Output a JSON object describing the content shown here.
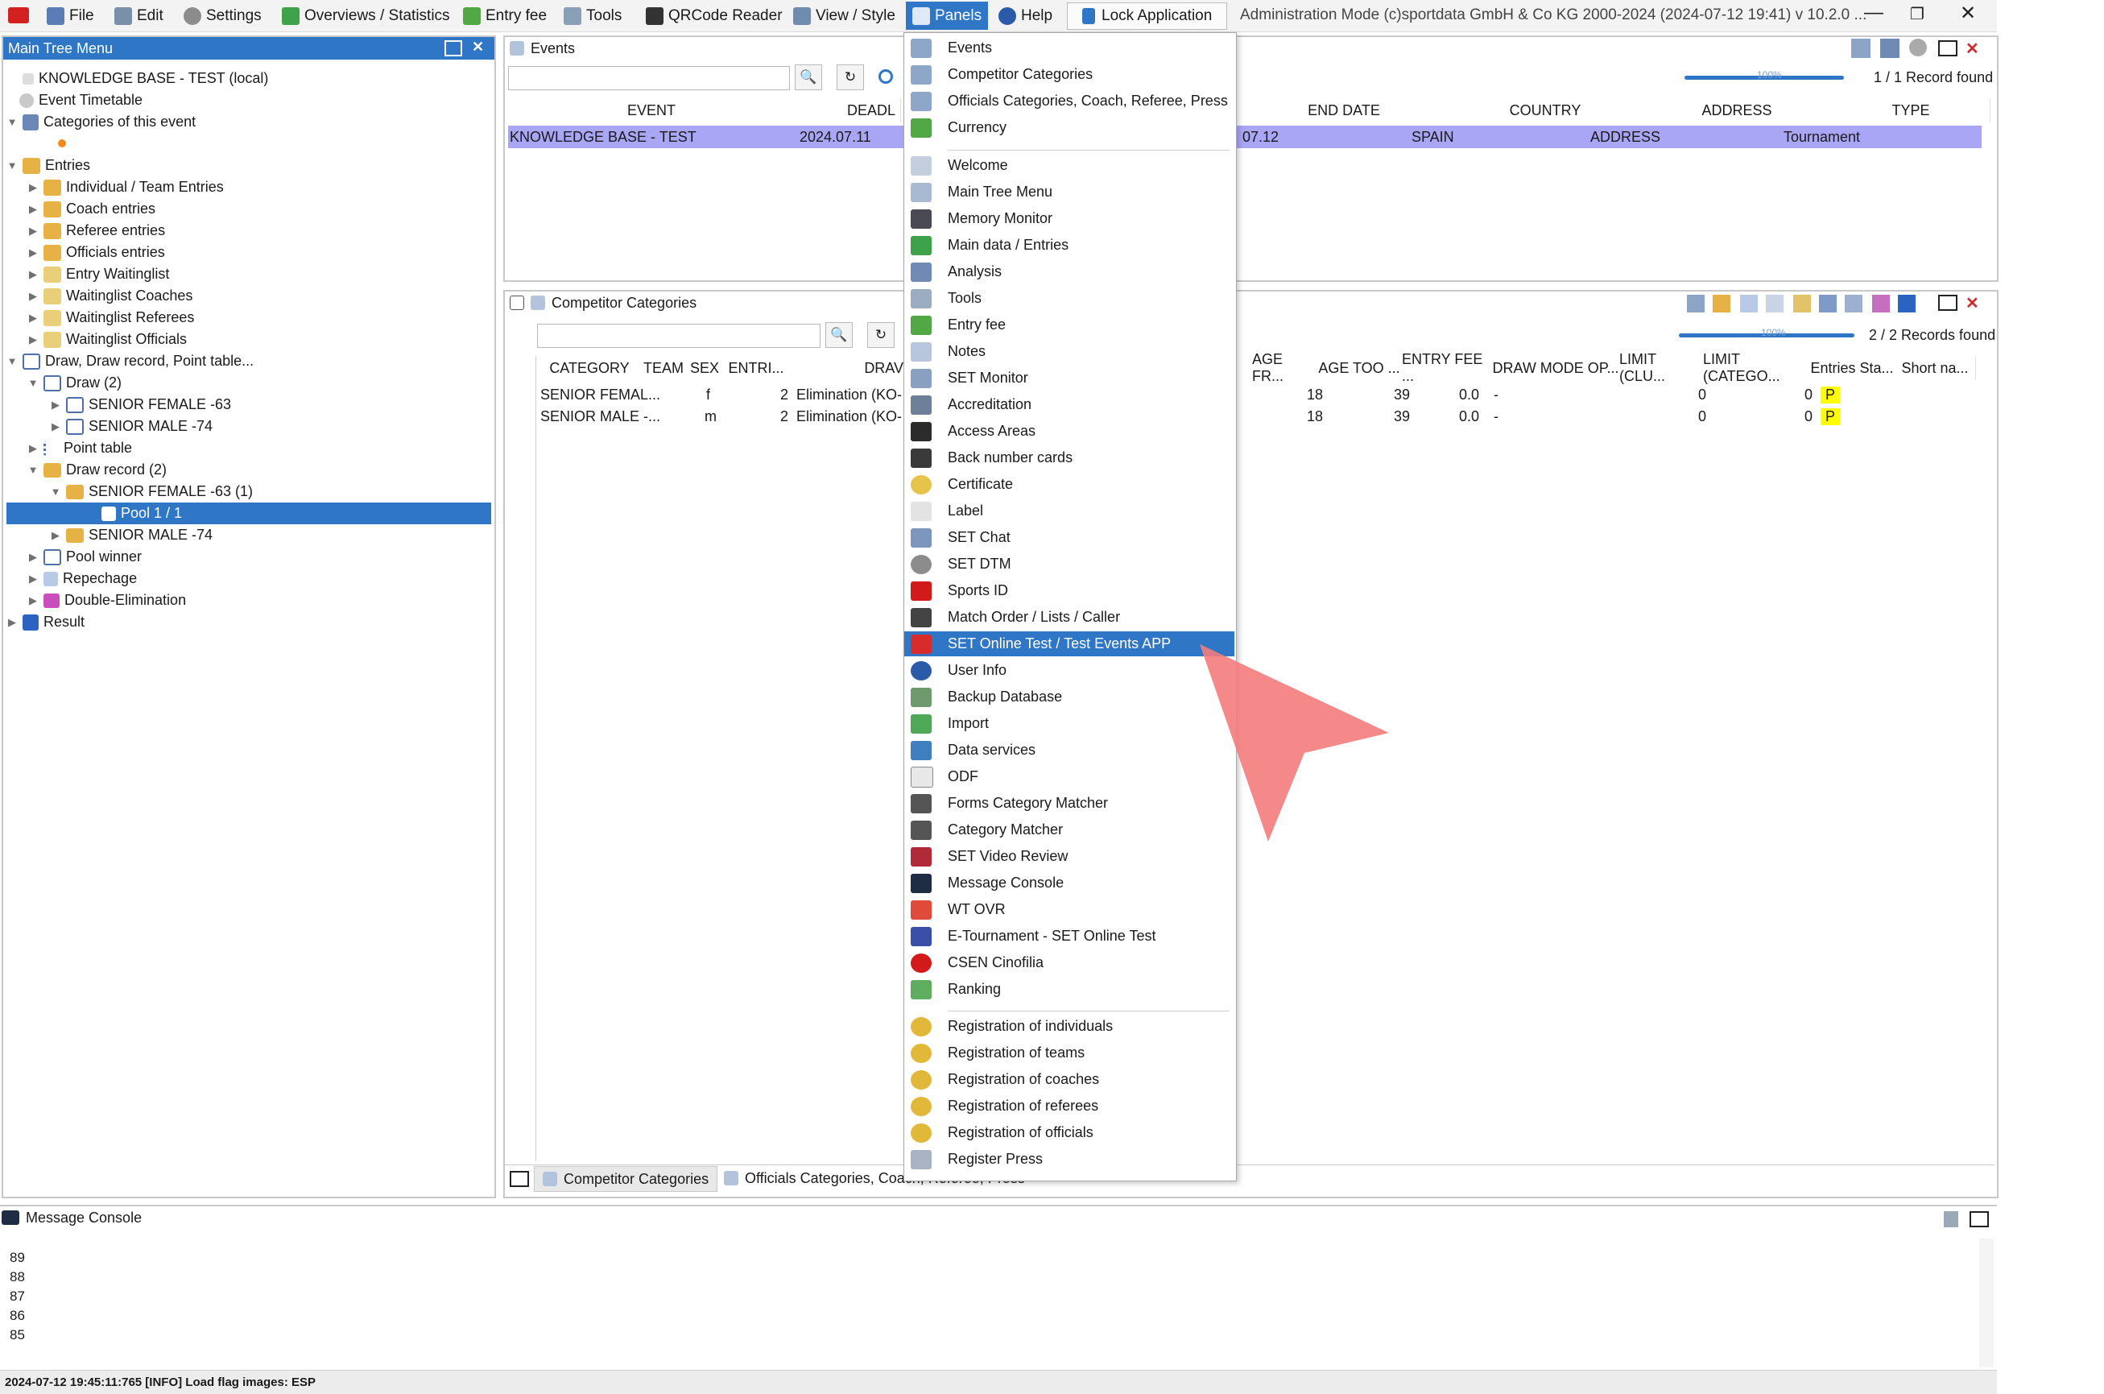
{
  "menubar": {
    "items": [
      "File",
      "Edit",
      "Settings",
      "Overviews / Statistics",
      "Entry fee",
      "Tools",
      "QRCode Reader",
      "View / Style",
      "Panels",
      "Help"
    ],
    "lock": "Lock Application",
    "title": "Administration Mode (c)sportdata GmbH & Co KG 2000-2024 (2024-07-12 19:41)  v 10.2.0 ..."
  },
  "tree": {
    "title": "Main Tree Menu",
    "rows": [
      "KNOWLEDGE BASE - TEST (local)",
      "Event Timetable",
      "Categories of this event",
      "Entries",
      "Individual / Team Entries",
      "Coach entries",
      "Referee entries",
      "Officials entries",
      "Entry Waitinglist",
      "Waitinglist Coaches",
      "Waitinglist Referees",
      "Waitinglist Officials",
      "Draw, Draw record, Point table...",
      "Draw (2)",
      "SENIOR FEMALE -63",
      "SENIOR MALE -74",
      "Point table",
      "Draw record (2)",
      "SENIOR FEMALE -63 (1)",
      "Pool 1 / 1",
      "SENIOR MALE -74",
      "Pool winner",
      "Repechage",
      "Double-Elimination",
      "Result"
    ]
  },
  "events": {
    "title": "Events",
    "records": "1 / 1 Record found",
    "progress_label": "100%",
    "columns": [
      "EVENT",
      "DEADL",
      "END DATE",
      "COUNTRY",
      "ADDRESS",
      "TYPE"
    ],
    "row": {
      "event": "KNOWLEDGE BASE - TEST",
      "deadline": "2024.07.11",
      "end": "07.12",
      "country": "SPAIN",
      "address": "ADDRESS",
      "type": "Tournament"
    }
  },
  "categories": {
    "title": "Competitor Categories",
    "records": "2 / 2 Records found",
    "progress_label": "100%",
    "columns": [
      "CATEGORY",
      "TEAM",
      "SEX",
      "ENTRI...",
      "DRAV",
      "AGE FR...",
      "AGE TOO ...",
      "ENTRY FEE ...",
      "DRAW MODE OP...",
      "LIMIT (CLU...",
      "LIMIT (CATEGO...",
      "Entries Sta...",
      "Short na..."
    ],
    "rows": [
      {
        "cat": "SENIOR FEMAL...",
        "sex": "f",
        "entries": "2",
        "draw": "Elimination (KO-",
        "age_from": "18",
        "age_to": "39",
        "fee": "0.0",
        "mode": "-",
        "limit_club": "0",
        "limit_cat": "0",
        "status": "P"
      },
      {
        "cat": "SENIOR MALE -...",
        "sex": "m",
        "entries": "2",
        "draw": "Elimination (KO-",
        "age_from": "18",
        "age_to": "39",
        "fee": "0.0",
        "mode": "-",
        "limit_club": "0",
        "limit_cat": "0",
        "status": "P"
      }
    ],
    "tabs": [
      "Competitor Categories",
      "Officials Categories, Coach, Referee, Press"
    ]
  },
  "panels_menu": {
    "group1": [
      "Events",
      "Competitor Categories",
      "Officials Categories, Coach, Referee, Press",
      "Currency"
    ],
    "group2": [
      "Welcome",
      "Main Tree Menu",
      "Memory Monitor",
      "Main data / Entries",
      "Analysis",
      "Tools",
      "Entry fee",
      "Notes",
      "SET Monitor",
      "Accreditation",
      "Access Areas",
      "Back number cards",
      "Certificate",
      "Label",
      "SET Chat",
      "SET DTM",
      "Sports ID",
      "Match Order / Lists / Caller",
      "SET Online Test / Test Events APP",
      "User Info",
      "Backup Database",
      "Import",
      "Data services",
      "ODF",
      "Forms Category Matcher",
      "Category Matcher",
      "SET Video Review",
      "Message Console",
      "WT OVR",
      "E-Tournament - SET Online Test",
      "CSEN Cinofilia",
      "Ranking"
    ],
    "group3": [
      "Registration of individuals",
      "Registration of teams",
      "Registration of coaches",
      "Registration of referees",
      "Registration of officials",
      "Register Press"
    ],
    "highlighted": "SET Online Test / Test Events APP"
  },
  "console": {
    "title": "Message Console",
    "lines": [
      "89",
      "88",
      "87",
      "86",
      "85"
    ]
  },
  "status": "2024-07-12 19:45:11:765 [INFO] Load flag images: ESP"
}
